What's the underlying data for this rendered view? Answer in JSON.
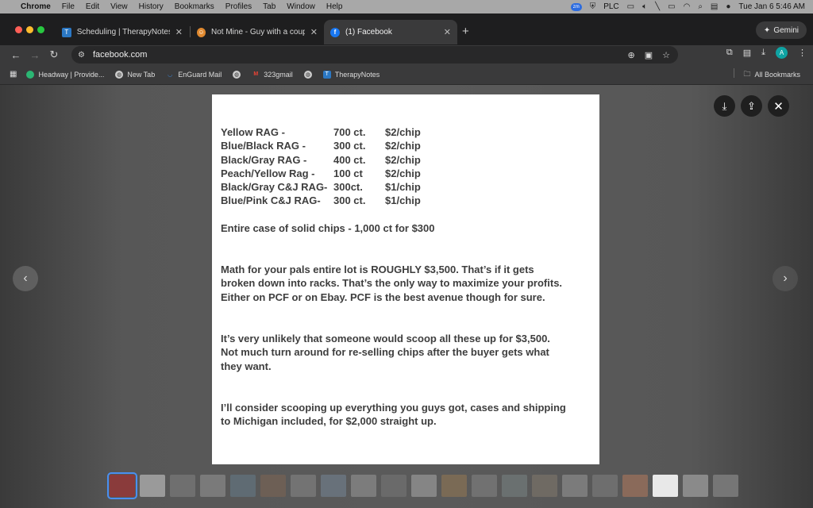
{
  "menubar": {
    "app": "Chrome",
    "items": [
      "File",
      "Edit",
      "View",
      "History",
      "Bookmarks",
      "Profiles",
      "Tab",
      "Window",
      "Help"
    ],
    "zoom_badge": "zm",
    "vpn_label": "PLC",
    "datetime": "Tue Jan 6  5:46 AM"
  },
  "tabs": [
    {
      "title": "Scheduling | TherapyNotes",
      "color": "#2b78c4",
      "glyph": "T",
      "active": false
    },
    {
      "title": "Not Mine - Guy with a couple",
      "color": "#e0892f",
      "glyph": "☺",
      "active": false
    },
    {
      "title": "(1) Facebook",
      "color": "#1877f2",
      "glyph": "f",
      "active": true
    }
  ],
  "gemini_label": "Gemini",
  "url": "facebook.com",
  "bookmarks": [
    {
      "label": "Headway | Provide...",
      "color": "#2bb673"
    },
    {
      "label": "New Tab",
      "color": "#cccccc"
    },
    {
      "label": "EnGuard Mail",
      "color": "#3a8ee6"
    },
    {
      "label": "",
      "color": "#cccccc"
    },
    {
      "label": "323gmail",
      "color": "#ea4335"
    },
    {
      "label": "",
      "color": "#cccccc"
    },
    {
      "label": "TherapyNotes",
      "color": "#2b78c4"
    }
  ],
  "all_bookmarks": "All Bookmarks",
  "image_text": {
    "price_rows": [
      {
        "item": "Yellow RAG -",
        "count": "700 ct.",
        "price": "$2/chip"
      },
      {
        "item": "Blue/Black RAG -",
        "count": "300 ct.",
        "price": "$2/chip"
      },
      {
        "item": "Black/Gray RAG -",
        "count": "400 ct.",
        "price": "$2/chip"
      },
      {
        "item": "Peach/Yellow Rag -",
        "count": "100 ct",
        "price": "$2/chip"
      },
      {
        "item": "Black/Gray C&J RAG-",
        "count": "300ct.",
        "price": "$1/chip"
      },
      {
        "item": "Blue/Pink C&J RAG-",
        "count": "300 ct.",
        "price": "$1/chip"
      }
    ],
    "case_line": "Entire case of solid chips - 1,000 ct for $300",
    "para1": [
      "Math for your pals entire lot is ROUGHLY $3,500. That’s if it gets",
      "broken down into racks. That’s the only way to maximize your profits.",
      "Either on PCF or on Ebay. PCF is the best avenue though for sure."
    ],
    "para2": [
      "It’s very unlikely that someone would scoop all these up for $3,500.",
      "Not much turn around for re-selling chips after the  buyer gets what",
      "they want."
    ],
    "para3": [
      "I’ll consider scooping up everything you guys got, cases and shipping",
      "to Michigan included, for $2,000 straight up."
    ]
  },
  "filmstrip_count": 21
}
